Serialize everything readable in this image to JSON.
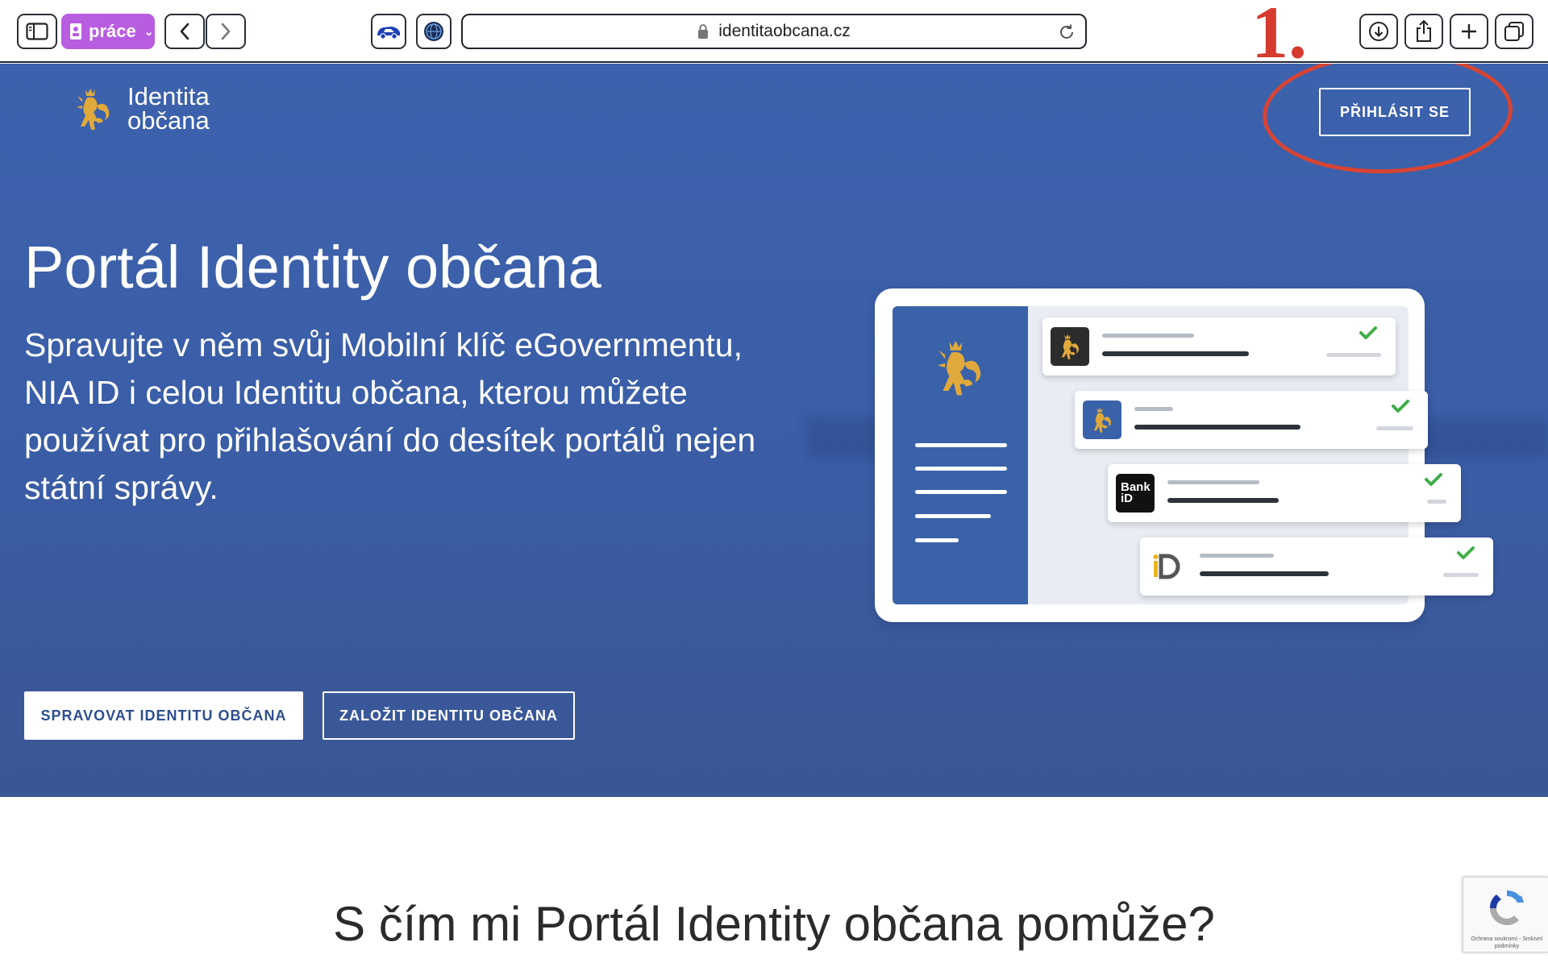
{
  "browser": {
    "profile_label": "práce",
    "url": "identitaobcana.cz"
  },
  "annotation": {
    "step_number": "1."
  },
  "site": {
    "brand_line1": "Identita",
    "brand_line2": "občana",
    "login_label": "PŘIHLÁSIT SE"
  },
  "hero": {
    "title": "Portál Identity občana",
    "subtitle": "Spravujte v něm svůj Mobilní klíč eGovernmentu, NIA ID i celou Identitu občana, kterou můžete používat pro přihlašování do desítek portálů nejen státní správy.",
    "cta_manage": "SPRAVOVAT IDENTITU OBČANA",
    "cta_create": "ZALOŽIT IDENTITU OBČANA"
  },
  "illustration": {
    "bank_logo": "Bank iD"
  },
  "section": {
    "title": "S čím mi Portál Identity občana pomůže?"
  },
  "recaptcha": {
    "footer": "Ochrana soukromí - Smluvní podmínky"
  },
  "colors": {
    "hero_bg": "#3d62ad",
    "annotation_red": "#d63a2f",
    "profile_purple": "#b85ce0",
    "lion_gold": "#e0a93b",
    "check_green": "#3fae49"
  },
  "icons": [
    "sidebar-icon",
    "profile-icon",
    "back-icon",
    "forward-icon",
    "extension-car-icon",
    "extension-globe-icon",
    "lock-icon",
    "reload-icon",
    "download-icon",
    "share-icon",
    "new-tab-icon",
    "tabs-icon",
    "lion-emblem-icon",
    "check-icon",
    "recaptcha-icon"
  ]
}
